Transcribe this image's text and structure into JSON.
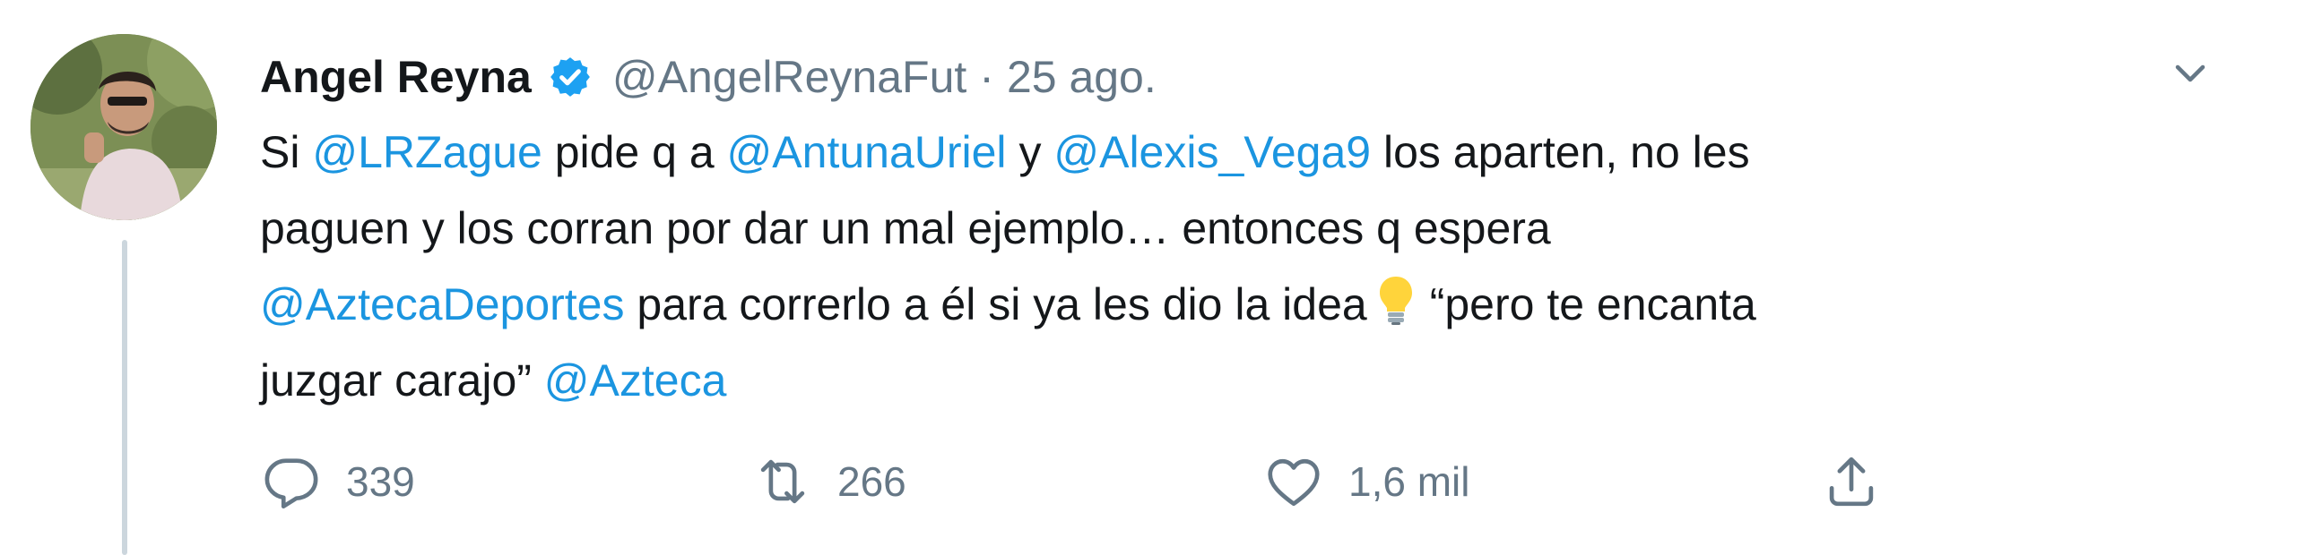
{
  "tweet": {
    "author_name": "Angel Reyna",
    "handle": "@AngelReynaFut",
    "separator": "·",
    "date": "25 ago.",
    "body": {
      "line1": {
        "t1": "Si ",
        "m1": "@LRZague",
        "t2": " pide q a ",
        "m2": "@AntunaUriel",
        "t3": " y ",
        "m3": "@Alexis_Vega9",
        "t4": " los aparten, no les"
      },
      "line2": {
        "t1": "paguen y los corran por dar un mal ejemplo… entonces q espera"
      },
      "line3": {
        "m1": "@AztecaDeportes",
        "t1": " para correrlo a él si ya les dio la idea",
        "emoji": "light-bulb-emoji",
        "t2": "“pero te encanta"
      },
      "line4": {
        "t1": "juzgar carajo” ",
        "m1": "@Azteca"
      }
    },
    "actions": {
      "reply_count": "339",
      "retweet_count": "266",
      "like_count": "1,6 mil"
    },
    "icons": {
      "verified": "verified-badge-icon",
      "more": "chevron-down-icon",
      "reply": "reply-icon",
      "retweet": "retweet-icon",
      "like": "heart-icon",
      "share": "share-icon"
    },
    "colors": {
      "text": "#14171a",
      "secondary": "#657786",
      "link": "#1b95e0",
      "verified": "#1da1f2",
      "thread_line": "#ccd6dd"
    }
  }
}
